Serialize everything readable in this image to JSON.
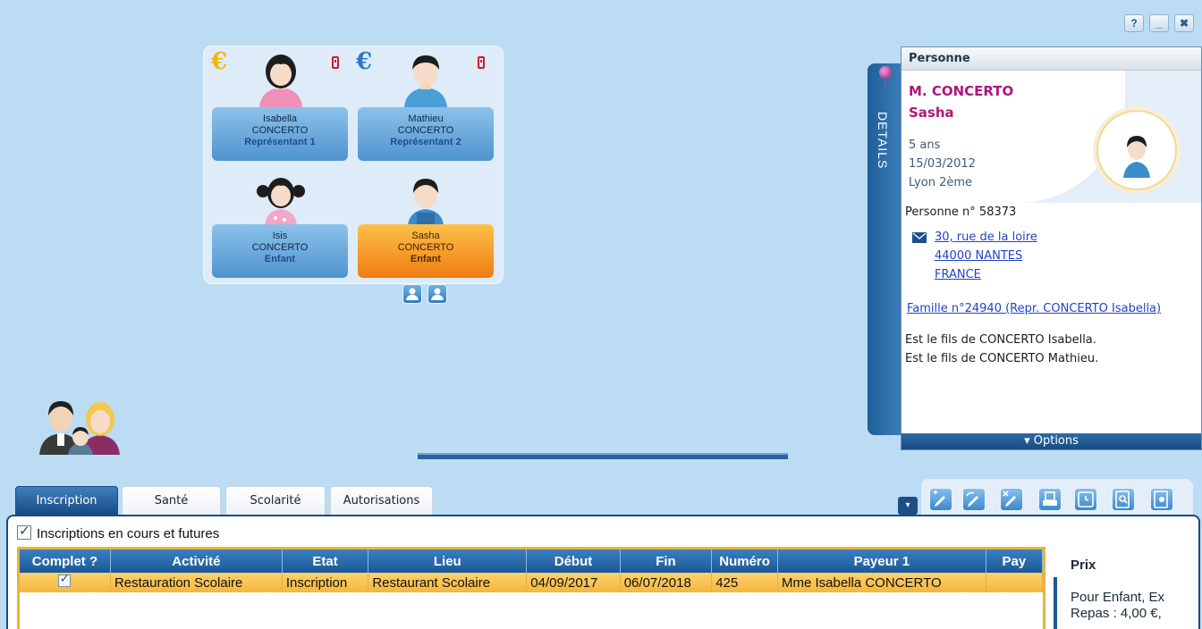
{
  "window_controls": {
    "help": "?",
    "minimize": "_",
    "close": "✖"
  },
  "family": {
    "members": [
      {
        "first": "Isabella",
        "last": "CONCERTO",
        "role": "Représentant 1"
      },
      {
        "first": "Mathieu",
        "last": "CONCERTO",
        "role": "Représentant 2"
      },
      {
        "first": "Isis",
        "last": "CONCERTO",
        "role": "Enfant"
      },
      {
        "first": "Sasha",
        "last": "CONCERTO",
        "role": "Enfant"
      }
    ],
    "euro_symbol": "€",
    "colors": {
      "euro_payer": "#f2b705",
      "euro_other": "#2a78c6",
      "selected": "#ef7d12"
    }
  },
  "details": {
    "tab_label": "DETAILS",
    "header": "Personne",
    "name_line1": "M. CONCERTO",
    "name_line2": "Sasha",
    "age": "5 ans",
    "birth_date": "15/03/2012",
    "birth_place": "Lyon 2ème",
    "person_number": "Personne n° 58373",
    "address": {
      "street": "30, rue de la loire",
      "city": "44000 NANTES",
      "country": "FRANCE"
    },
    "family_link": "Famille n°24940 (Repr. CONCERTO Isabella)",
    "relations": [
      "Est le fils de CONCERTO Isabella.",
      "Est le fils de CONCERTO Mathieu."
    ],
    "options_label": "▾ Options"
  },
  "tabs": [
    "Inscription",
    "Santé",
    "Scolarité",
    "Autorisations"
  ],
  "toolbar": {
    "dropdown": "▾"
  },
  "inscriptions": {
    "filter_label": "Inscriptions en cours et futures",
    "columns": [
      "Complet ?",
      "Activité",
      "Etat",
      "Lieu",
      "Début",
      "Fin",
      "Numéro",
      "Payeur 1",
      "Pay"
    ],
    "rows": [
      {
        "activite": "Restauration Scolaire",
        "etat": "Inscription",
        "lieu": "Restaurant Scolaire",
        "debut": "04/09/2017",
        "fin": "06/07/2018",
        "numero": "425",
        "payeur": "Mme Isabella CONCERTO",
        "pay2": ""
      }
    ]
  },
  "price": {
    "title": "Prix",
    "line1": "Pour Enfant, Ex",
    "line2": "Repas : 4,00 €,"
  }
}
